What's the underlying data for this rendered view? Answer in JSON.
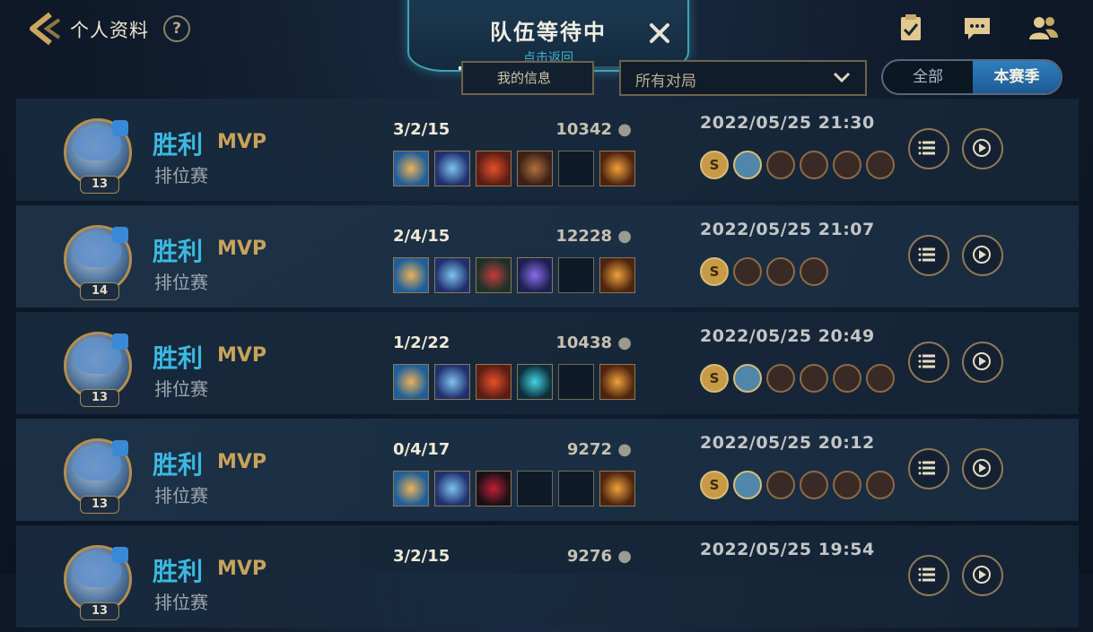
{
  "header": {
    "title": "个人资料",
    "help_glyph": "?"
  },
  "queue": {
    "title": "队伍等待中",
    "subtitle": "点击返回",
    "close_glyph": "✕"
  },
  "filters": {
    "left_label": "我的信息",
    "dropdown_value": "所有对局",
    "segments": [
      "全部",
      "本赛季"
    ],
    "active_segment": "本赛季"
  },
  "matches": [
    {
      "level": "13",
      "result": "胜利",
      "mvp": "MVP",
      "mode": "排位赛",
      "kda": "3/2/15",
      "gold": "10342",
      "date": "2022/05/25 21:30",
      "items": [
        "trident-item",
        "dragon-item",
        "fire-orb-item",
        "tome-item",
        "empty",
        "spikes-item"
      ],
      "badges": [
        "S",
        "flag",
        "wings",
        "heart",
        "eye",
        "tower"
      ]
    },
    {
      "level": "14",
      "result": "胜利",
      "mvp": "MVP",
      "mode": "排位赛",
      "kda": "2/4/15",
      "gold": "12228",
      "date": "2022/05/25 21:07",
      "items": [
        "trident-item",
        "dragon-item",
        "mask-item",
        "crystal-item",
        "empty",
        "spikes-item"
      ],
      "badges": [
        "S",
        "heart",
        "eye",
        "drop"
      ]
    },
    {
      "level": "13",
      "result": "胜利",
      "mvp": "MVP",
      "mode": "排位赛",
      "kda": "1/2/22",
      "gold": "10438",
      "date": "2022/05/25 20:49",
      "items": [
        "trident-item",
        "dragon-item",
        "fire-orb-item",
        "spirit-item",
        "empty",
        "spikes-item"
      ],
      "badges": [
        "S",
        "flag",
        "wings",
        "heart",
        "eye",
        "tower"
      ]
    },
    {
      "level": "13",
      "result": "胜利",
      "mvp": "MVP",
      "mode": "排位赛",
      "kda": "0/4/17",
      "gold": "9272",
      "date": "2022/05/25 20:12",
      "items": [
        "trident-item",
        "dragon-item",
        "ruby-item",
        "empty",
        "empty",
        "spikes-item"
      ],
      "badges": [
        "S",
        "flag",
        "wings",
        "heart",
        "eye",
        "tower"
      ]
    },
    {
      "level": "13",
      "result": "胜利",
      "mvp": "MVP",
      "mode": "排位赛",
      "kda": "3/2/15",
      "gold": "9276",
      "date": "2022/05/25 19:54",
      "items": [],
      "badges": []
    }
  ],
  "colors": {
    "accent_blue": "#3bb8e0",
    "mvp_gold": "#c8a35a",
    "frame_gold": "#b68e4c"
  }
}
